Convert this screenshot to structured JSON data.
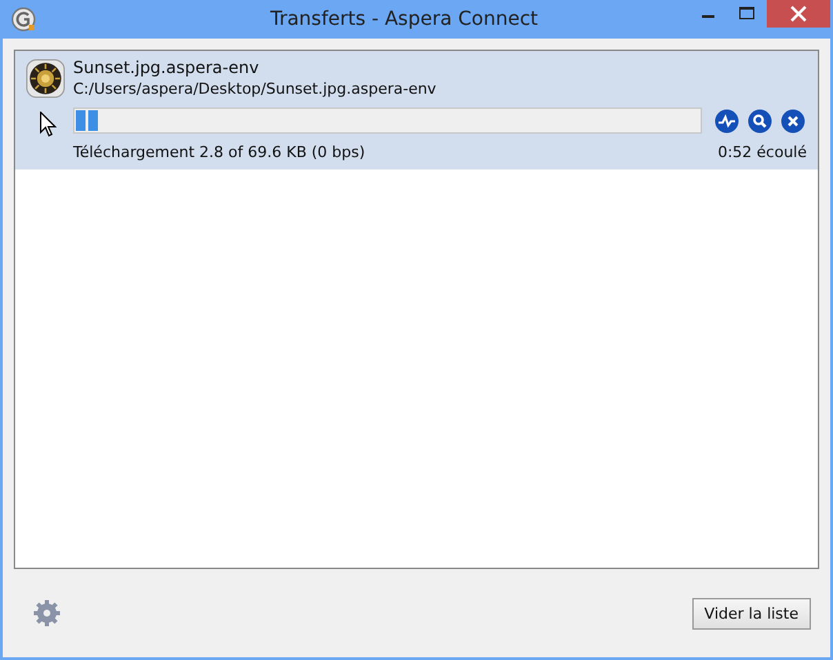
{
  "window": {
    "title": "Transferts - Aspera Connect"
  },
  "transfers": [
    {
      "name": "Sunset.jpg.aspera-env",
      "path": "C:/Users/aspera/Desktop/Sunset.jpg.aspera-env",
      "level": 0.04,
      "status": "Téléchargement 2.8 of 69.6 KB (0 bps)",
      "elapsed": "0:52 écoulé",
      "selected": true
    }
  ],
  "buttons": [
    "Vider la liste"
  ]
}
